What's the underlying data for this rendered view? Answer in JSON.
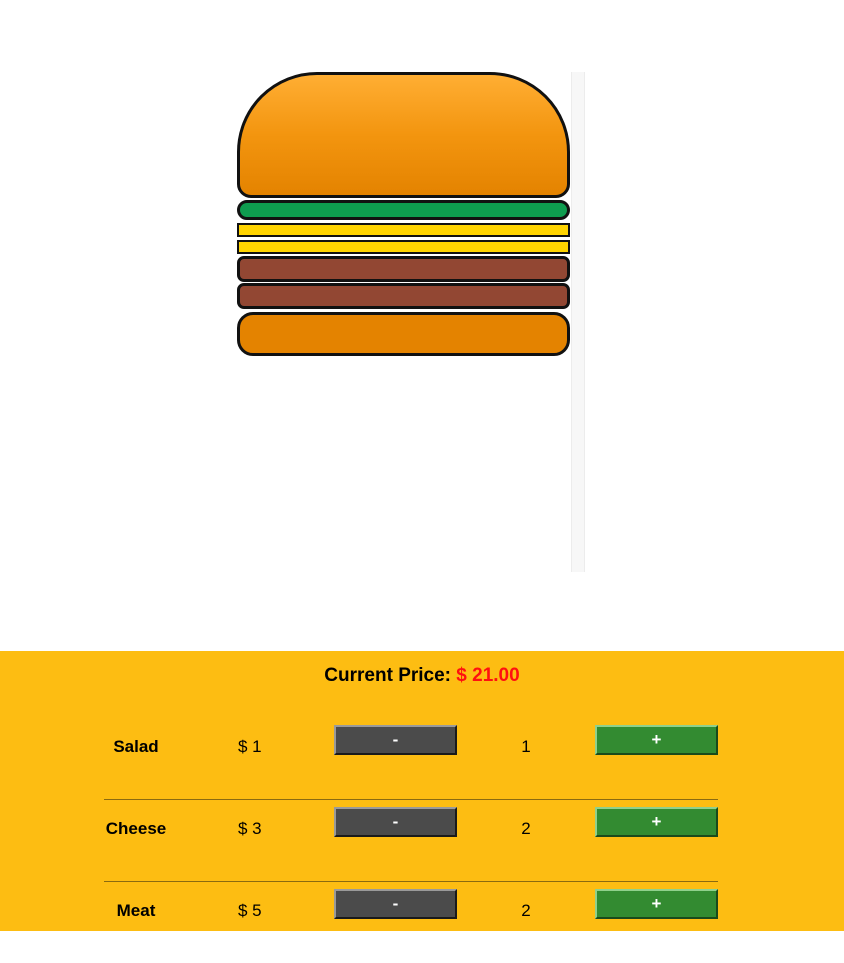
{
  "price": {
    "label": "Current Price:",
    "value": "$ 21.00"
  },
  "ingredients": [
    {
      "name": "Salad",
      "price": "$ 1",
      "minus_label": "-",
      "quantity": "1",
      "plus_label": "+"
    },
    {
      "name": "Cheese",
      "price": "$ 3",
      "minus_label": "-",
      "quantity": "2",
      "plus_label": "+"
    },
    {
      "name": "Meat",
      "price": "$ 5",
      "minus_label": "-",
      "quantity": "2",
      "plus_label": "+"
    }
  ],
  "colors": {
    "controls_background": "#fdbd12",
    "price_value": "#ff1010",
    "minus_button": "#4b4b4b",
    "plus_button": "#338b31",
    "bun": "#e48300",
    "salad": "#0e9c4f",
    "cheese": "#ffd400",
    "meat": "#924733"
  }
}
